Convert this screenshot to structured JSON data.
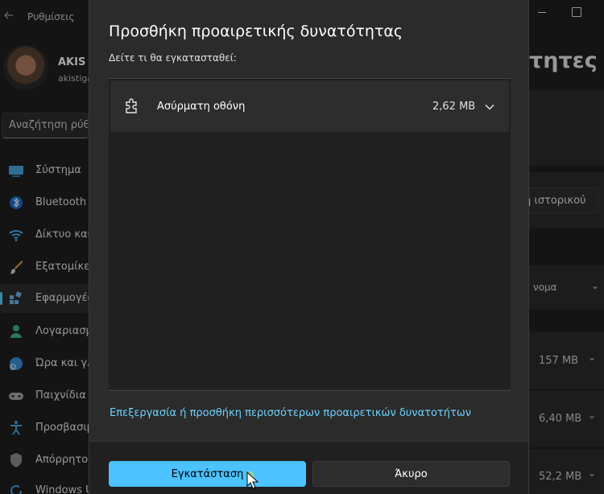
{
  "app": {
    "title": "Ρυθμίσεις"
  },
  "user": {
    "name": "AKIS t",
    "email": "akistiga"
  },
  "search": {
    "placeholder": "Αναζήτηση ρύθ"
  },
  "sidebar": {
    "items": [
      {
        "label": "Σύστημα",
        "icon": "monitor-icon"
      },
      {
        "label": "Bluetooth κ",
        "icon": "bluetooth-icon"
      },
      {
        "label": "Δίκτυο και",
        "icon": "wifi-icon"
      },
      {
        "label": "Εξατομίκευ",
        "icon": "brush-icon"
      },
      {
        "label": "Εφαρμογές",
        "icon": "apps-icon",
        "active": true
      },
      {
        "label": "Λογαριασμ",
        "icon": "person-icon"
      },
      {
        "label": "Ώρα και γλ",
        "icon": "clock-globe-icon"
      },
      {
        "label": "Παιχνίδια",
        "icon": "gamepad-icon"
      },
      {
        "label": "Προσβασιμ",
        "icon": "accessibility-icon"
      },
      {
        "label": "Απόρρητο",
        "icon": "shield-icon"
      },
      {
        "label": "Windows U",
        "icon": "update-icon"
      }
    ]
  },
  "background": {
    "heading": "τητες",
    "history_button": "ή ιστορικού",
    "sort_label": "νομα",
    "sizes": [
      "157 MB",
      "6,40 MB",
      "52,2 MB"
    ]
  },
  "dialog": {
    "title": "Προσθήκη προαιρετικής δυνατότητας",
    "subtitle": "Δείτε τι θα εγκατασταθεί:",
    "feature": {
      "name": "Ασύρματη οθόνη",
      "size": "2,62 MB",
      "icon": "puzzle-icon"
    },
    "link": "Επεξεργασία ή προσθήκη περισσότερων προαιρετικών δυνατοτήτων",
    "install_button": "Εγκατάσταση",
    "cancel_button": "Άκυρο"
  },
  "colors": {
    "accent": "#4cc2ff",
    "link": "#6fd2ff",
    "dialog_bg": "#2b2b2b"
  }
}
